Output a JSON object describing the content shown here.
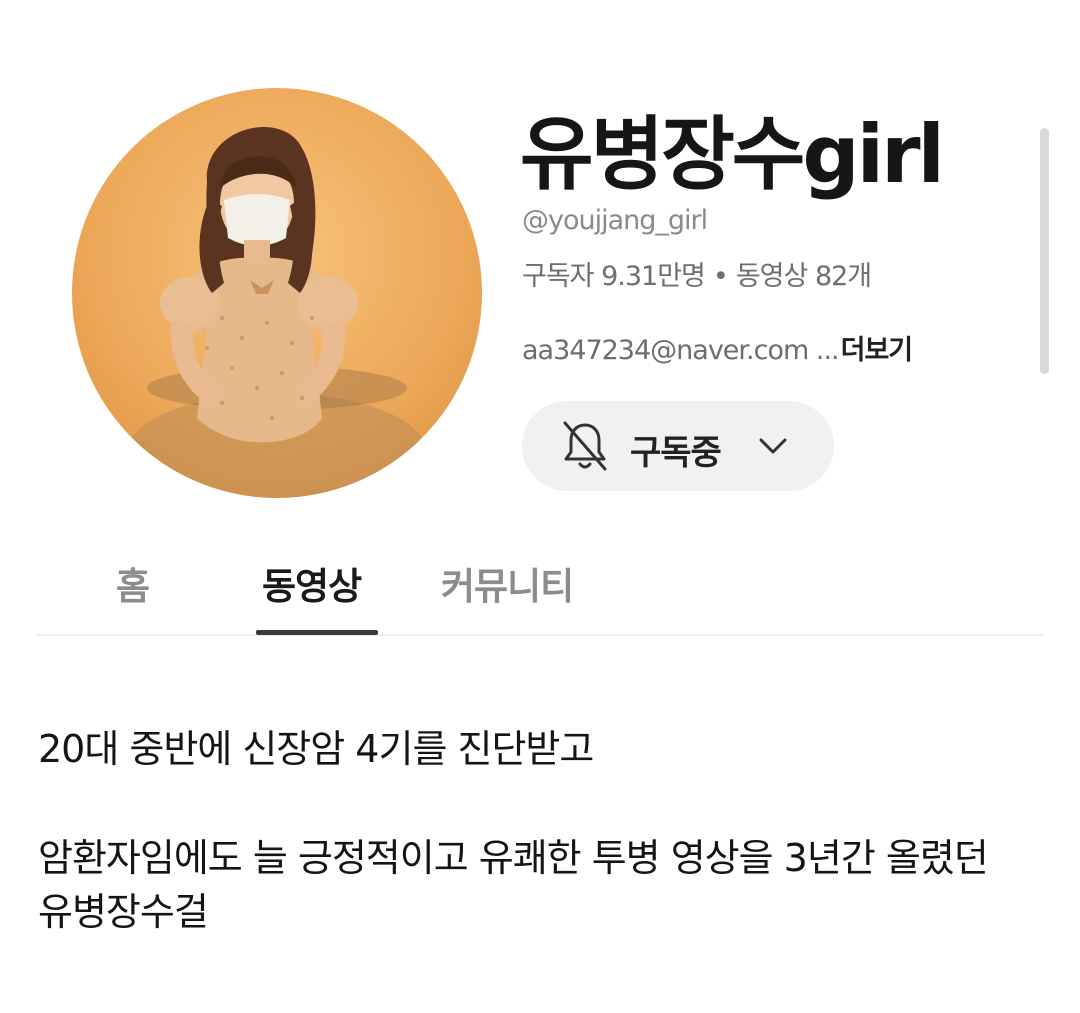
{
  "channel": {
    "name": "유병장수girl",
    "handle": "@youjjang_girl",
    "subscribers": "구독자 9.31만명",
    "separator": "•",
    "videos": "동영상 82개",
    "description": "aa347234@naver.com ...",
    "more_label": "더보기"
  },
  "subscribe_button": {
    "label": "구독중",
    "bell_icon": "bell-off-icon",
    "chevron_icon": "chevron-down-icon"
  },
  "tabs": [
    {
      "label": "홈",
      "active": false
    },
    {
      "label": "동영상",
      "active": true
    },
    {
      "label": "커뮤니티",
      "active": false
    }
  ],
  "caption": {
    "line1": "20대 중반에 신장암 4기를 진단받고",
    "line2": "암환자임에도 늘 긍정적이고 유쾌한 투병 영상을 3년간 올렸던",
    "line3": "유병장수걸"
  },
  "colors": {
    "avatar_background": "#eea95a",
    "active_tab": "#1a1a1a",
    "inactive_tab": "#8c8c8c",
    "button_background": "#f1f1f1"
  }
}
